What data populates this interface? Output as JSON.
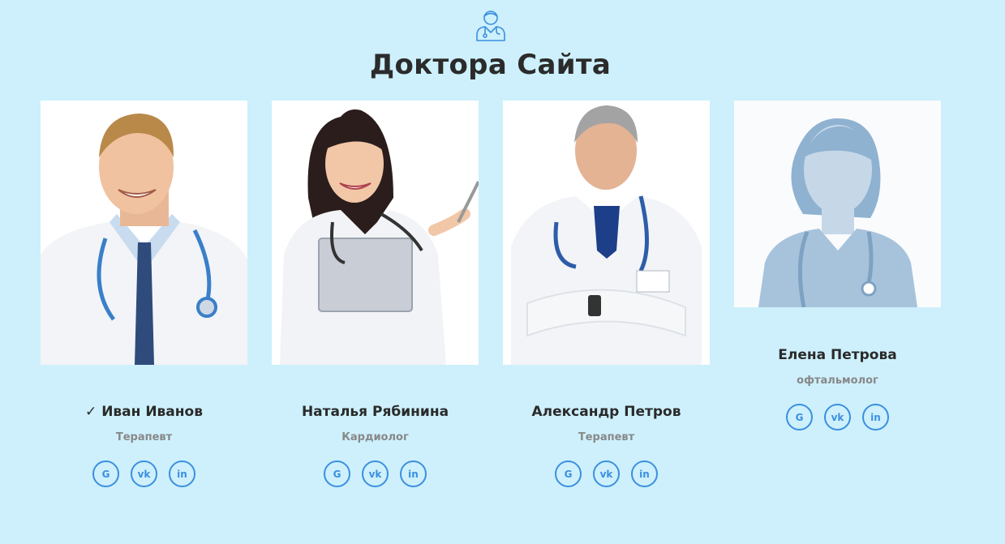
{
  "section": {
    "title": "Доктора Сайта"
  },
  "social_labels": {
    "google": "G",
    "vk": "vk",
    "linkedin": "in"
  },
  "doctors": [
    {
      "name": "✓ Иван Иванов",
      "specialty": "Терапевт",
      "photo": "male-doctor-smiling-photo"
    },
    {
      "name": "Наталья Рябинина",
      "specialty": "Кардиолог",
      "photo": "female-doctor-clipboard-photo"
    },
    {
      "name": "Александр Петров",
      "specialty": "Терапевт",
      "photo": "male-doctor-arms-crossed-photo"
    },
    {
      "name": "Елена Петрова",
      "specialty": "офтальмолог",
      "photo": "female-doctor-placeholder-avatar"
    }
  ],
  "colors": {
    "background": "#cdf0fc",
    "accent": "#3b8fe0",
    "title": "#2b2b2b",
    "muted": "#888888"
  }
}
